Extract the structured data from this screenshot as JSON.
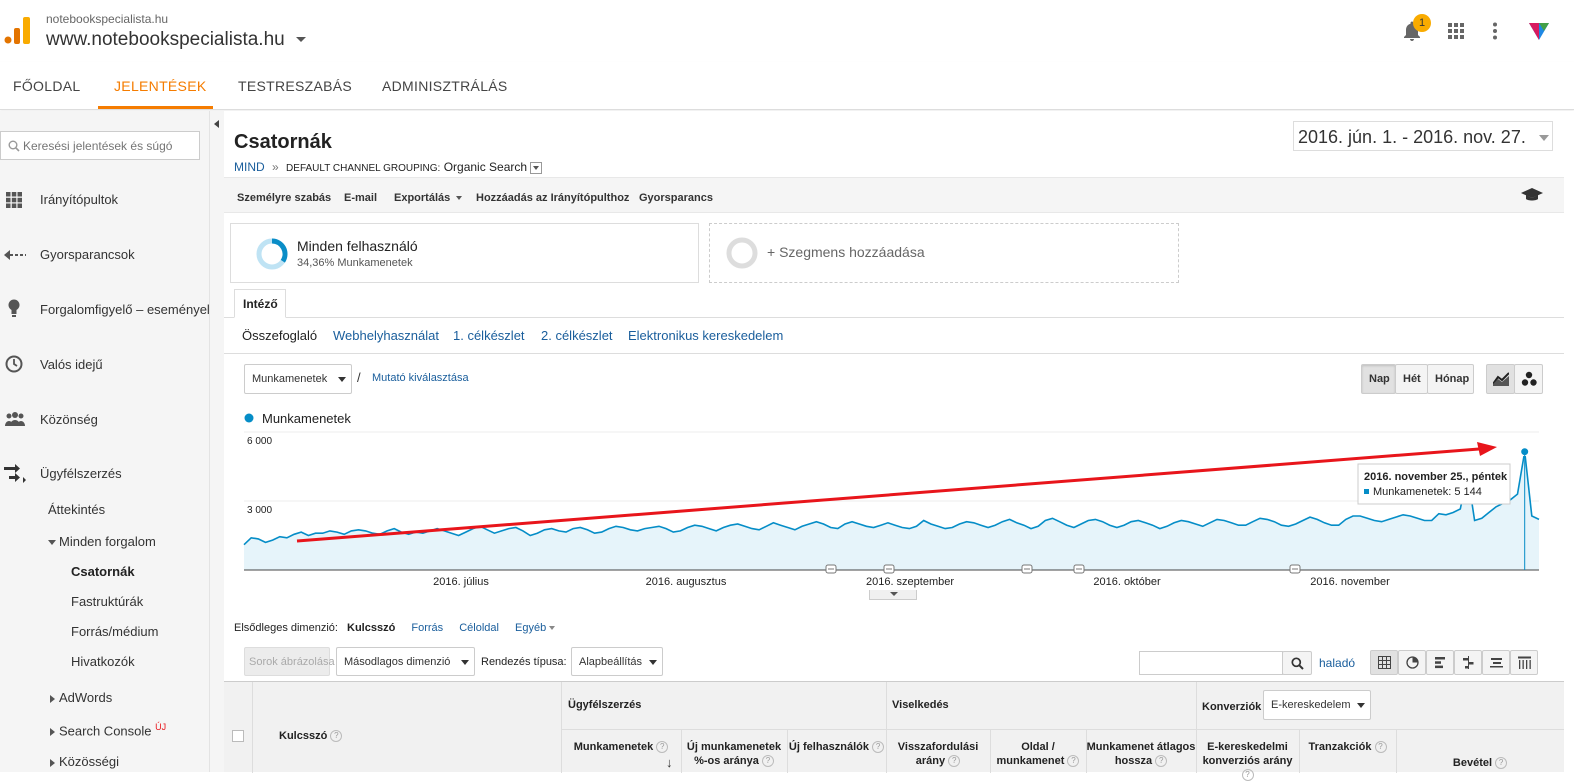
{
  "header": {
    "account_name": "notebookspecialista.hu",
    "property_name": "www.notebookspecialista.hu",
    "notification_count": "1"
  },
  "nav": {
    "tabs": [
      {
        "label": "FŐOLDAL"
      },
      {
        "label": "JELENTÉSEK"
      },
      {
        "label": "TESTRESZABÁS"
      },
      {
        "label": "ADMINISZTRÁLÁS"
      }
    ],
    "active_tab": "JELENTÉSEK"
  },
  "sidebar": {
    "search_placeholder": "Keresési jelentések és súgó",
    "items": [
      {
        "label": "Irányítópultok",
        "icon": "grid-icon"
      },
      {
        "label": "Gyorsparancsok",
        "icon": "shortcut-arrow-icon"
      },
      {
        "label": "Forgalomfigyelő – eseményel",
        "icon": "lightbulb-icon"
      },
      {
        "label": "Valós idejű",
        "icon": "clock-icon"
      },
      {
        "label": "Közönség",
        "icon": "people-icon"
      },
      {
        "label": "Ügyfélszerzés",
        "icon": "acquisition-arrows-icon"
      }
    ],
    "acquisition_children": {
      "overview": "Áttekintés",
      "all_traffic": "Minden forgalom",
      "all_traffic_children": [
        "Csatornák",
        "Fastruktúrák",
        "Forrás/médium",
        "Hivatkozók"
      ],
      "adwords": "AdWords",
      "search_console": "Search Console",
      "search_console_badge": "ÚJ",
      "social": "Közösségi"
    },
    "active_item": "Csatornák"
  },
  "report": {
    "title": "Csatornák",
    "breadcrumb_root": "MIND",
    "breadcrumb_sep": "»",
    "breadcrumb_label": "DEFAULT CHANNEL GROUPING:",
    "breadcrumb_value": "Organic Search",
    "date_range": "2016. jún. 1. - 2016. nov. 27.",
    "toolbar": {
      "customize": "Személyre szabás",
      "email": "E-mail",
      "export": "Exportálás",
      "add_dashboard": "Hozzáadás az Irányítópulthoz",
      "shortcut": "Gyorsparancs"
    }
  },
  "segments": {
    "active_name": "Minden felhasználó",
    "active_detail": "34,36% Munkamenetek",
    "active_percent": 34.36,
    "add_label": "+ Szegmens hozzáadása"
  },
  "explorer": {
    "tab": "Intéző",
    "subtabs": [
      "Összefoglaló",
      "Webhelyhasználat",
      "1. célkészlet",
      "2. célkészlet",
      "Elektronikus kereskedelem"
    ],
    "active_subtab": "Összefoglaló",
    "metric_select": "Munkamenetek",
    "metric_sep": "/",
    "choose_metric": "Mutató kiválasztása",
    "granularity": [
      "Nap",
      "Hét",
      "Hónap"
    ],
    "active_granularity": "Nap"
  },
  "chart_data": {
    "type": "line",
    "series": [
      {
        "name": "Munkamenetek",
        "values": [
          1100,
          1400,
          1350,
          1200,
          1300,
          1450,
          1400,
          1550,
          1650,
          1500,
          1600,
          1600,
          1700,
          1650,
          1550,
          1700,
          1750,
          1700,
          1600,
          1550,
          1700,
          1800,
          1650,
          1550,
          1650,
          1600,
          1700,
          1800,
          1700,
          1600,
          1500,
          1650,
          1800,
          1900,
          1750,
          1600,
          1700,
          1800,
          1850,
          1700,
          1500,
          1600,
          1750,
          1800,
          1700,
          1650,
          1800,
          1850,
          1750,
          1600,
          1650,
          1800,
          1900,
          1850,
          1750,
          1700,
          1800,
          1850,
          1900,
          1800,
          1650,
          1700,
          1850,
          1950,
          1900,
          1800,
          1700,
          1850,
          1950,
          2000,
          1900,
          1800,
          1750,
          1900,
          2050,
          1950,
          1850,
          1750,
          1900,
          2000,
          2100,
          2000,
          1850,
          1800,
          2000,
          2100,
          2000,
          1900,
          1850,
          1950,
          2050,
          1950,
          1850,
          1800,
          1900,
          2150,
          2000,
          1900,
          1800,
          1850,
          2000,
          2100,
          2050,
          1950,
          1850,
          1950,
          2100,
          2200,
          2050,
          1950,
          1800,
          1900,
          2150,
          2250,
          2100,
          1950,
          1850,
          2000,
          2150,
          2200,
          2100,
          1950,
          1850,
          1950,
          2100,
          2150,
          2050,
          1950,
          1800,
          1900,
          2050,
          2150,
          2100,
          2000,
          1900,
          2050,
          2200,
          2150,
          2050,
          1950,
          1950,
          2100,
          2250,
          2200,
          2100,
          1950,
          1900,
          2000,
          2150,
          2300,
          2200,
          2050,
          1950,
          1950,
          2200,
          2350,
          2350,
          2250,
          2150,
          2100,
          2200,
          2300,
          2400,
          2350,
          2250,
          2150,
          2150,
          2450,
          2400,
          2500,
          2650,
          4200,
          2150,
          2250,
          2500,
          2750,
          2900,
          3050,
          3300,
          5144,
          2350,
          2200
        ]
      }
    ],
    "yticks": [
      "6 000",
      "3 000"
    ],
    "ylim": [
      0,
      6000
    ],
    "x_ticks": [
      "2016. július",
      "2016. augusztus",
      "2016. szeptember",
      "2016. október",
      "2016. november"
    ],
    "tooltip": {
      "date": "2016. november 25., péntek",
      "metric": "Munkamenetek:",
      "value": "5 144"
    },
    "legend_placement": "top-left",
    "grid": true
  },
  "table_controls": {
    "primary_dimension_label": "Elsődleges dimenzió:",
    "dimensions": [
      "Kulcsszó",
      "Forrás",
      "Céloldal",
      "Egyéb"
    ],
    "active_dimension": "Kulcsszó",
    "plot_rows": "Sorok ábrázolása",
    "secondary_dimension": "Másodlagos dimenzió",
    "sort_label": "Rendezés típusa:",
    "sort_value": "Alapbeállítás",
    "advanced": "haladó",
    "search_value": ""
  },
  "table": {
    "key_column": "Kulcsszó",
    "group_acquisition": "Ügyfélszerzés",
    "group_behavior": "Viselkedés",
    "group_conversions": "Konverziók",
    "conversion_select": "E-kereskedelem",
    "columns": [
      "Munkamenetek",
      "Új munkamenetek %-os aránya",
      "Új felhasználók",
      "Visszafordulási arány",
      "Oldal / munkamenet",
      "Munkamenet átlagos hossza",
      "E-kereskedelmi konverziós arány",
      "Tranzakciók",
      "Bevétel"
    ],
    "help_glyph": "?"
  },
  "colors": {
    "accent": "#f57c00",
    "series": "#058dc7",
    "link": "#1a5e9c",
    "annotation_arrow": "#e8151b"
  }
}
